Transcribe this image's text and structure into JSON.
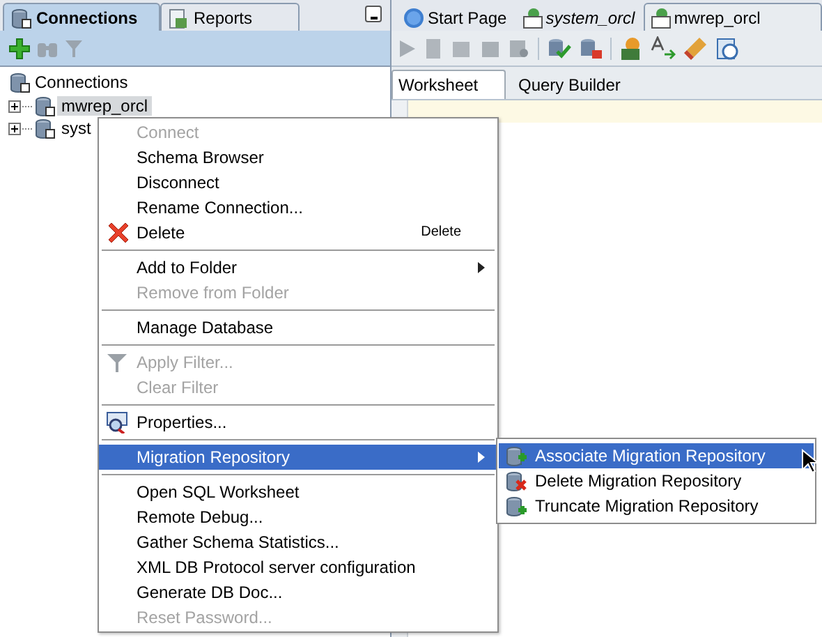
{
  "left_panel": {
    "tabs": [
      {
        "label": "Connections",
        "selected": true
      },
      {
        "label": "Reports",
        "selected": false
      }
    ],
    "tree": {
      "label": "Connections",
      "children": [
        {
          "label": "mwrep_orcl",
          "selected": true,
          "expanded": false
        },
        {
          "label": "syst",
          "selected": false,
          "expanded": false
        }
      ]
    }
  },
  "right_panel": {
    "tabs": [
      {
        "label": "Start Page",
        "selected": false,
        "italic": false
      },
      {
        "label": "system_orcl",
        "selected": false,
        "italic": true
      },
      {
        "label": "mwrep_orcl",
        "selected": true,
        "italic": false
      }
    ],
    "subtabs": [
      {
        "label": "Worksheet",
        "selected": true
      },
      {
        "label": "Query Builder",
        "selected": false
      }
    ]
  },
  "context_menu": [
    {
      "kind": "item",
      "label": "Connect",
      "disabled": true
    },
    {
      "kind": "item",
      "label": "Schema Browser",
      "disabled": false
    },
    {
      "kind": "item",
      "label": "Disconnect",
      "disabled": false
    },
    {
      "kind": "item",
      "label": "Rename Connection...",
      "disabled": false
    },
    {
      "kind": "item",
      "label": "Delete",
      "disabled": false,
      "shortcut": "Delete"
    },
    {
      "kind": "separator"
    },
    {
      "kind": "item",
      "label": "Add to Folder",
      "disabled": false,
      "submenu": true
    },
    {
      "kind": "item",
      "label": "Remove from Folder",
      "disabled": true
    },
    {
      "kind": "separator"
    },
    {
      "kind": "item",
      "label": "Manage Database",
      "disabled": false
    },
    {
      "kind": "separator"
    },
    {
      "kind": "item",
      "label": "Apply Filter...",
      "disabled": true
    },
    {
      "kind": "item",
      "label": "Clear Filter",
      "disabled": true
    },
    {
      "kind": "separator"
    },
    {
      "kind": "item",
      "label": "Properties...",
      "disabled": false
    },
    {
      "kind": "separator"
    },
    {
      "kind": "item",
      "label": "Migration Repository",
      "disabled": false,
      "submenu": true,
      "selected": true
    },
    {
      "kind": "separator"
    },
    {
      "kind": "item",
      "label": "Open SQL Worksheet",
      "disabled": false
    },
    {
      "kind": "item",
      "label": "Remote Debug...",
      "disabled": false
    },
    {
      "kind": "item",
      "label": "Gather Schema Statistics...",
      "disabled": false
    },
    {
      "kind": "item",
      "label": "XML DB Protocol server configuration",
      "disabled": false
    },
    {
      "kind": "item",
      "label": "Generate DB Doc...",
      "disabled": false
    },
    {
      "kind": "item",
      "label": "Reset Password...",
      "disabled": true
    }
  ],
  "submenu": [
    {
      "label": "Associate Migration Repository",
      "selected": true
    },
    {
      "label": "Delete Migration Repository",
      "selected": false
    },
    {
      "label": "Truncate Migration Repository",
      "selected": false
    }
  ]
}
